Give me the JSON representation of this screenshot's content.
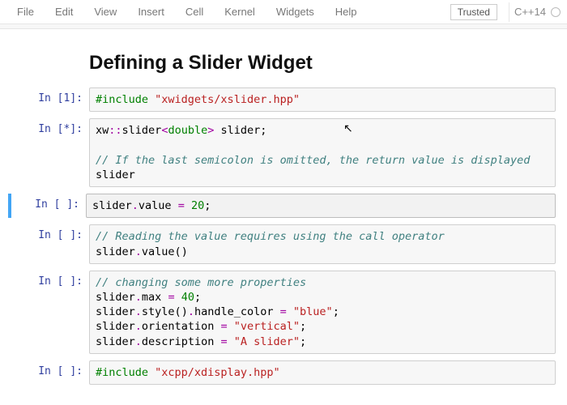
{
  "menubar": {
    "items": [
      "File",
      "Edit",
      "View",
      "Insert",
      "Cell",
      "Kernel",
      "Widgets",
      "Help"
    ],
    "trusted": "Trusted",
    "kernel": "C++14"
  },
  "heading": "Defining a Slider Widget",
  "cells": [
    {
      "prompt": "In [1]:",
      "tokens": [
        {
          "t": "#include ",
          "c": "tok-pp"
        },
        {
          "t": "\"xwidgets/xslider.hpp\"",
          "c": "tok-str"
        }
      ]
    },
    {
      "prompt": "In [*]:",
      "tokens": [
        {
          "t": "xw",
          "c": ""
        },
        {
          "t": "::",
          "c": "tok-op"
        },
        {
          "t": "slider",
          "c": ""
        },
        {
          "t": "<",
          "c": "tok-angle"
        },
        {
          "t": "double",
          "c": "tok-type"
        },
        {
          "t": ">",
          "c": "tok-angle"
        },
        {
          "t": " slider;",
          "c": ""
        },
        {
          "t": "\n\n",
          "c": ""
        },
        {
          "t": "// If the last semicolon is omitted, the return value is displayed",
          "c": "tok-cmt"
        },
        {
          "t": "\n",
          "c": ""
        },
        {
          "t": "slider",
          "c": ""
        }
      ]
    },
    {
      "prompt": "In [ ]:",
      "selected": true,
      "tokens": [
        {
          "t": "slider",
          "c": ""
        },
        {
          "t": ".",
          "c": "tok-op"
        },
        {
          "t": "value ",
          "c": ""
        },
        {
          "t": "=",
          "c": "tok-op"
        },
        {
          "t": " ",
          "c": ""
        },
        {
          "t": "20",
          "c": "tok-num"
        },
        {
          "t": ";",
          "c": ""
        }
      ]
    },
    {
      "prompt": "In [ ]:",
      "tokens": [
        {
          "t": "// Reading the value requires using the call operator",
          "c": "tok-cmt"
        },
        {
          "t": "\n",
          "c": ""
        },
        {
          "t": "slider",
          "c": ""
        },
        {
          "t": ".",
          "c": "tok-op"
        },
        {
          "t": "value()",
          "c": ""
        }
      ]
    },
    {
      "prompt": "In [ ]:",
      "tokens": [
        {
          "t": "// changing some more properties",
          "c": "tok-cmt"
        },
        {
          "t": "\n",
          "c": ""
        },
        {
          "t": "slider",
          "c": ""
        },
        {
          "t": ".",
          "c": "tok-op"
        },
        {
          "t": "max ",
          "c": ""
        },
        {
          "t": "=",
          "c": "tok-op"
        },
        {
          "t": " ",
          "c": ""
        },
        {
          "t": "40",
          "c": "tok-num"
        },
        {
          "t": ";",
          "c": ""
        },
        {
          "t": "\n",
          "c": ""
        },
        {
          "t": "slider",
          "c": ""
        },
        {
          "t": ".",
          "c": "tok-op"
        },
        {
          "t": "style()",
          "c": ""
        },
        {
          "t": ".",
          "c": "tok-op"
        },
        {
          "t": "handle_color ",
          "c": ""
        },
        {
          "t": "=",
          "c": "tok-op"
        },
        {
          "t": " ",
          "c": ""
        },
        {
          "t": "\"blue\"",
          "c": "tok-str"
        },
        {
          "t": ";",
          "c": ""
        },
        {
          "t": "\n",
          "c": ""
        },
        {
          "t": "slider",
          "c": ""
        },
        {
          "t": ".",
          "c": "tok-op"
        },
        {
          "t": "orientation ",
          "c": ""
        },
        {
          "t": "=",
          "c": "tok-op"
        },
        {
          "t": " ",
          "c": ""
        },
        {
          "t": "\"vertical\"",
          "c": "tok-str"
        },
        {
          "t": ";",
          "c": ""
        },
        {
          "t": "\n",
          "c": ""
        },
        {
          "t": "slider",
          "c": ""
        },
        {
          "t": ".",
          "c": "tok-op"
        },
        {
          "t": "description ",
          "c": ""
        },
        {
          "t": "=",
          "c": "tok-op"
        },
        {
          "t": " ",
          "c": ""
        },
        {
          "t": "\"A slider\"",
          "c": "tok-str"
        },
        {
          "t": ";",
          "c": ""
        }
      ]
    },
    {
      "prompt": "In [ ]:",
      "tokens": [
        {
          "t": "#include ",
          "c": "tok-pp"
        },
        {
          "t": "\"xcpp/xdisplay.hpp\"",
          "c": "tok-str"
        }
      ]
    }
  ]
}
